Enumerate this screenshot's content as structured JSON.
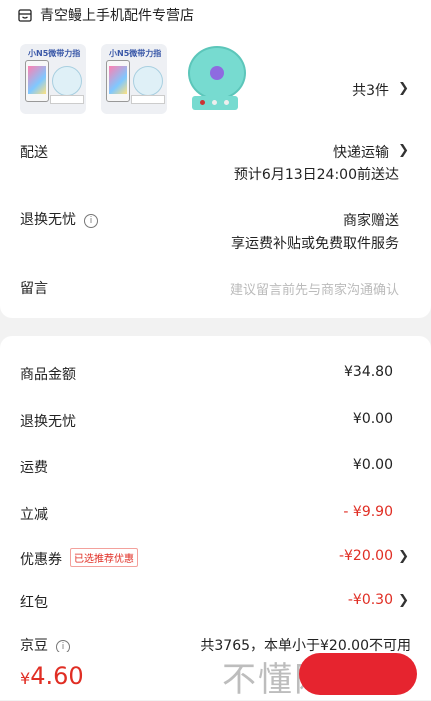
{
  "store": {
    "name": "青空鳗上手机配件专营店",
    "icon": "store-icon"
  },
  "products": {
    "count_label": "共3件",
    "thumb_tag": "小N5微带力指",
    "thumbnails": [
      "phone-fan-product",
      "phone-fan-product",
      "teal-mini-fan"
    ]
  },
  "delivery": {
    "label": "配送",
    "method": "快递运输",
    "eta": "预计6月13日24:00前送达"
  },
  "return_service": {
    "label": "退换无忧",
    "value": "商家赠送",
    "desc": "享运费补贴或免费取件服务"
  },
  "message": {
    "label": "留言",
    "placeholder": "建议留言前先与商家沟通确认"
  },
  "summary": {
    "goods_label": "商品金额",
    "goods_value": "¥34.80",
    "return_label": "退换无忧",
    "return_value": "¥0.00",
    "shipping_label": "运费",
    "shipping_value": "¥0.00",
    "discount_label": "立减",
    "discount_value": "- ¥9.90",
    "coupon_label": "优惠券",
    "coupon_badge": "已选推荐优惠",
    "coupon_value": "-¥20.00",
    "redpacket_label": "红包",
    "redpacket_value": "-¥0.30",
    "points_label": "京豆",
    "points_value": "共3765，本单小于¥20.00不可用"
  },
  "footer": {
    "currency": "¥",
    "total": "4.60",
    "watermark": "不懂网"
  },
  "colors": {
    "accent": "#e02e24",
    "pay_button": "#e6242f"
  }
}
